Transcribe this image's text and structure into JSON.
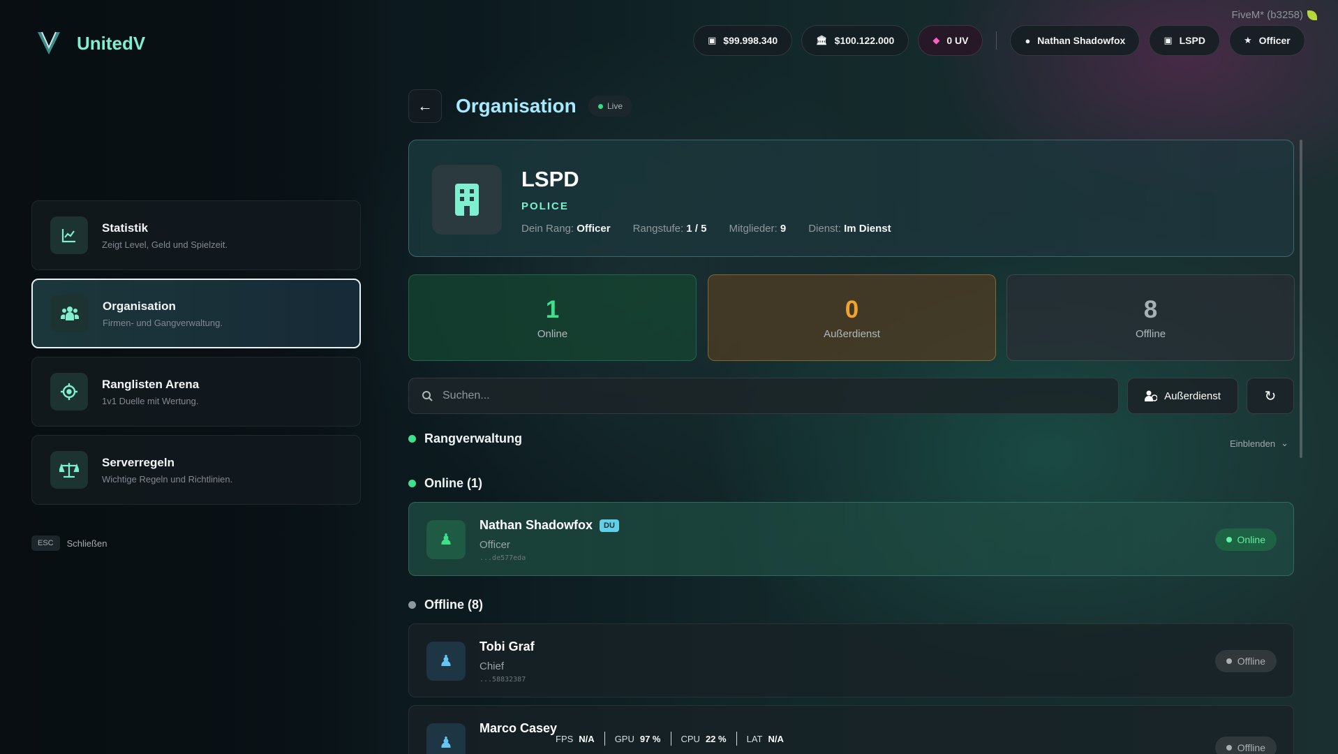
{
  "client": {
    "label": "FiveM* (b3258)"
  },
  "brand": {
    "name": "UnitedV"
  },
  "header": {
    "cash": "$99.998.340",
    "bank": "$100.122.000",
    "uv": "0 UV",
    "player": "Nathan Shadowfox",
    "org": "LSPD",
    "rank": "Officer"
  },
  "nav": {
    "items": [
      {
        "title": "Statistik",
        "subtitle": "Zeigt Level, Geld und Spielzeit.",
        "icon": "chart-line-icon"
      },
      {
        "title": "Organisation",
        "subtitle": "Firmen- und Gangverwaltung.",
        "icon": "users-icon"
      },
      {
        "title": "Ranglisten Arena",
        "subtitle": "1v1 Duelle mit Wertung.",
        "icon": "crosshair-icon"
      },
      {
        "title": "Serverregeln",
        "subtitle": "Wichtige Regeln und Richtlinien.",
        "icon": "scale-icon"
      }
    ],
    "active": 1
  },
  "esc": {
    "key": "ESC",
    "label": "Schließen"
  },
  "page": {
    "title": "Organisation",
    "live": "Live"
  },
  "org": {
    "name": "LSPD",
    "type": "POLICE",
    "rank_label": "Dein Rang:",
    "rank_value": "Officer",
    "level_label": "Rangstufe:",
    "level_value": "1 / 5",
    "members_label": "Mitglieder:",
    "members_value": "9",
    "duty_label": "Dienst:",
    "duty_value": "Im Dienst"
  },
  "stats": {
    "online": {
      "value": "1",
      "label": "Online"
    },
    "offduty": {
      "value": "0",
      "label": "Außerdienst"
    },
    "offline": {
      "value": "8",
      "label": "Offline"
    }
  },
  "search": {
    "placeholder": "Suchen..."
  },
  "actions": {
    "duty": "Außerdienst"
  },
  "sections": {
    "ranks": "Rangverwaltung",
    "ranks_toggle": "Einblenden",
    "online": "Online (1)",
    "offline": "Offline (8)"
  },
  "members": [
    {
      "name": "Nathan Shadowfox",
      "badge": "DU",
      "rank": "Officer",
      "id": "...de577eda",
      "status": "Online"
    },
    {
      "name": "Tobi Graf",
      "rank": "Chief",
      "id": "...58832387",
      "status": "Offline"
    },
    {
      "name": "Marco Casey",
      "rank": "",
      "id": "",
      "status": "Offline"
    }
  ],
  "perf": {
    "fps_label": "FPS",
    "fps": "N/A",
    "gpu_label": "GPU",
    "gpu": "97 %",
    "cpu_label": "CPU",
    "cpu": "22 %",
    "lat_label": "LAT",
    "lat": "N/A"
  },
  "colors": {
    "accent": "#7ff0cf",
    "online": "#3ee08a",
    "offduty": "#f0a42a",
    "title": "#a7e9ff"
  }
}
